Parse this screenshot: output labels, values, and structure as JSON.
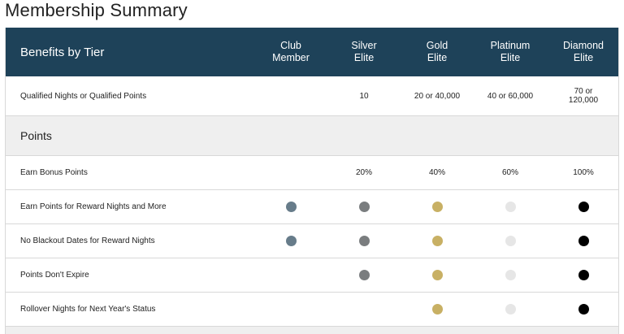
{
  "page": {
    "title": "Membership Summary"
  },
  "table": {
    "header_label": "Benefits by Tier",
    "tiers": [
      {
        "line1": "Club",
        "line2": "Member"
      },
      {
        "line1": "Silver",
        "line2": "Elite"
      },
      {
        "line1": "Gold",
        "line2": "Elite"
      },
      {
        "line1": "Platinum",
        "line2": "Elite"
      },
      {
        "line1": "Diamond",
        "line2": "Elite"
      }
    ],
    "qualified": {
      "label": "Qualified Nights or Qualified Points",
      "values": [
        "",
        "10",
        "20 or 40,000",
        "40 or 60,000",
        "70 or\n120,000"
      ]
    },
    "section_points": "Points",
    "rows": [
      {
        "label": "Earn Bonus Points",
        "values": [
          "",
          "20%",
          "40%",
          "60%",
          "100%"
        ]
      },
      {
        "label": "Earn Points for Reward Nights and More",
        "dots": [
          true,
          true,
          true,
          true,
          true
        ]
      },
      {
        "label": "No Blackout Dates for Reward Nights",
        "dots": [
          true,
          true,
          true,
          true,
          true
        ]
      },
      {
        "label": "Points Don't Expire",
        "dots": [
          false,
          true,
          true,
          true,
          true
        ]
      },
      {
        "label": "Rollover Nights for Next Year's Status",
        "dots": [
          false,
          false,
          true,
          true,
          true
        ]
      }
    ]
  },
  "tier_colors": [
    "#677c8a",
    "#7a7d7f",
    "#c8b064",
    "#e6e6e6",
    "#000000"
  ]
}
